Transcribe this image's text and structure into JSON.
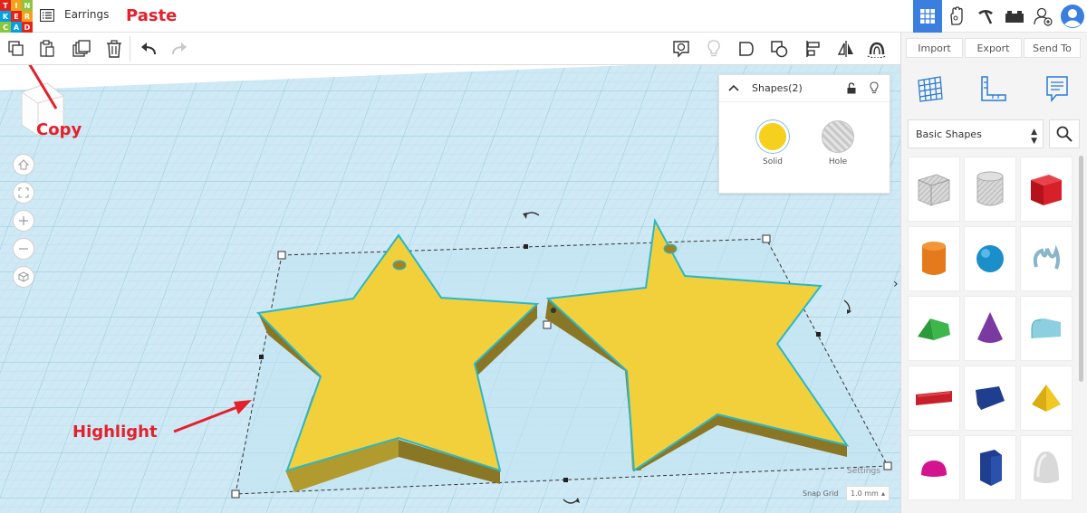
{
  "app": {
    "logo_letters": [
      "T",
      "I",
      "N",
      "K",
      "E",
      "R",
      "C",
      "A",
      "D"
    ],
    "logo_colors": [
      "#e2231a",
      "#f3a21c",
      "#8cc63f",
      "#00a0e3",
      "#e2231a",
      "#f3a21c",
      "#8cc63f",
      "#00a0e3",
      "#e2231a"
    ],
    "design_title": "Earrings"
  },
  "topbar": {
    "active_color": "#3a7ee0",
    "icons": [
      "grid-view-icon",
      "ar-hand-icon",
      "pickaxe-icon",
      "bricks-icon",
      "add-user-icon",
      "user-avatar-icon"
    ]
  },
  "toolbar": {
    "left_icons": [
      "copy-icon",
      "paste-icon",
      "duplicate-icon",
      "delete-icon",
      "undo-icon",
      "redo-icon"
    ],
    "right_icons": [
      "note-icon",
      "light-bulb-icon",
      "workplane-icon",
      "ruler-shape-icon",
      "align-icon",
      "mirror-icon",
      "group-icon"
    ]
  },
  "right_panel": {
    "import_label": "Import",
    "export_label": "Export",
    "send_to_label": "Send To",
    "shapes_dropdown": "Basic Shapes",
    "shapes": [
      "Box",
      "Cylinder hole",
      "Box red",
      "Cylinder",
      "Sphere",
      "Scribble",
      "Roof",
      "Cone",
      "Round Roof",
      "Text",
      "Wedge",
      "Pyramid",
      "Half Sphere",
      "Polygon",
      "Paraboloid"
    ]
  },
  "inspector": {
    "title": "Shapes(2)",
    "solid_label": "Solid",
    "hole_label": "Hole",
    "solid_color": "#f5d01c"
  },
  "canvas": {
    "settings_label": "Settings",
    "snap_grid_label": "Snap Grid",
    "snap_grid_value": "1.0 mm"
  },
  "annotations": {
    "paste": "Paste",
    "copy": "Copy",
    "highlight": "Highlight",
    "color": "#e4202b"
  },
  "colors": {
    "star_top": "#f2d03b",
    "star_side": "#8a7725",
    "star_outline": "#2bb7c8",
    "grid_bg": "#cde8f4",
    "grid_line": "#a6d2e6"
  }
}
